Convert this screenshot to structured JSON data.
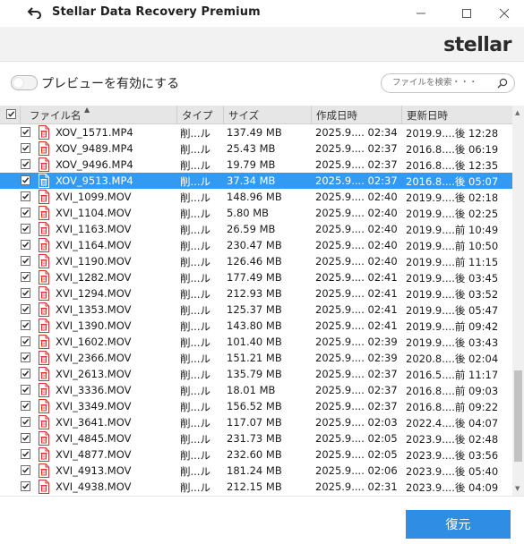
{
  "window": {
    "title": "Stellar Data Recovery Premium",
    "minimize_icon": "minimize-icon",
    "maximize_icon": "maximize-icon",
    "close_icon": "close-icon"
  },
  "brand": {
    "logo_prefix": "stel",
    "logo_mark": "l",
    "logo_suffix": "ar"
  },
  "toolbar": {
    "preview_toggle_label": "プレビューを有効にする",
    "preview_enabled": false,
    "search_placeholder": "ファイルを検索・・・"
  },
  "table": {
    "columns": [
      "ファイル名",
      "タイプ",
      "サイズ",
      "作成日時",
      "更新日時"
    ],
    "rows": [
      {
        "name": "XOV_1571.MP4",
        "type": "削...ル",
        "size": "137.49 MB",
        "created": "2025.9.... 02:34",
        "modified": "2019.9....後 12:28",
        "checked": true,
        "selected": false
      },
      {
        "name": "XOV_9489.MP4",
        "type": "削...ル",
        "size": "25.43 MB",
        "created": "2025.9.... 02:37",
        "modified": "2016.8....後 06:19",
        "checked": true,
        "selected": false
      },
      {
        "name": "XOV_9496.MP4",
        "type": "削...ル",
        "size": "19.79 MB",
        "created": "2025.9.... 02:37",
        "modified": "2016.8....後 12:35",
        "checked": true,
        "selected": false
      },
      {
        "name": "XOV_9513.MP4",
        "type": "削...ル",
        "size": "37.34 MB",
        "created": "2025.9.... 02:37",
        "modified": "2016.8....後 05:07",
        "checked": true,
        "selected": true
      },
      {
        "name": "XVI_1099.MOV",
        "type": "削...ル",
        "size": "148.96 MB",
        "created": "2025.9.... 02:40",
        "modified": "2019.9....後 02:18",
        "checked": true,
        "selected": false
      },
      {
        "name": "XVI_1104.MOV",
        "type": "削...ル",
        "size": "5.80 MB",
        "created": "2025.9.... 02:40",
        "modified": "2019.9....後 02:25",
        "checked": true,
        "selected": false
      },
      {
        "name": "XVI_1163.MOV",
        "type": "削...ル",
        "size": "26.59 MB",
        "created": "2025.9.... 02:40",
        "modified": "2019.9....前 10:49",
        "checked": true,
        "selected": false
      },
      {
        "name": "XVI_1164.MOV",
        "type": "削...ル",
        "size": "230.47 MB",
        "created": "2025.9.... 02:40",
        "modified": "2019.9....前 10:50",
        "checked": true,
        "selected": false
      },
      {
        "name": "XVI_1190.MOV",
        "type": "削...ル",
        "size": "126.46 MB",
        "created": "2025.9.... 02:40",
        "modified": "2019.9....前 11:15",
        "checked": true,
        "selected": false
      },
      {
        "name": "XVI_1282.MOV",
        "type": "削...ル",
        "size": "177.49 MB",
        "created": "2025.9.... 02:41",
        "modified": "2019.9....後 03:45",
        "checked": true,
        "selected": false
      },
      {
        "name": "XVI_1294.MOV",
        "type": "削...ル",
        "size": "212.93 MB",
        "created": "2025.9.... 02:41",
        "modified": "2019.9....後 03:52",
        "checked": true,
        "selected": false
      },
      {
        "name": "XVI_1353.MOV",
        "type": "削...ル",
        "size": "125.37 MB",
        "created": "2025.9.... 02:41",
        "modified": "2019.9....後 05:47",
        "checked": true,
        "selected": false
      },
      {
        "name": "XVI_1390.MOV",
        "type": "削...ル",
        "size": "143.80 MB",
        "created": "2025.9.... 02:41",
        "modified": "2019.9....前 09:42",
        "checked": true,
        "selected": false
      },
      {
        "name": "XVI_1602.MOV",
        "type": "削...ル",
        "size": "101.40 MB",
        "created": "2025.9.... 02:39",
        "modified": "2019.9....後 03:43",
        "checked": true,
        "selected": false
      },
      {
        "name": "XVI_2366.MOV",
        "type": "削...ル",
        "size": "151.21 MB",
        "created": "2025.9.... 02:39",
        "modified": "2020.8....後 02:04",
        "checked": true,
        "selected": false
      },
      {
        "name": "XVI_2613.MOV",
        "type": "削...ル",
        "size": "135.79 MB",
        "created": "2025.9.... 02:37",
        "modified": "2016.5....前 11:17",
        "checked": true,
        "selected": false
      },
      {
        "name": "XVI_3336.MOV",
        "type": "削...ル",
        "size": "18.01 MB",
        "created": "2025.9.... 02:37",
        "modified": "2016.8....前 09:03",
        "checked": true,
        "selected": false
      },
      {
        "name": "XVI_3349.MOV",
        "type": "削...ル",
        "size": "156.52 MB",
        "created": "2025.9.... 02:37",
        "modified": "2016.8....前 09:22",
        "checked": true,
        "selected": false
      },
      {
        "name": "XVI_3641.MOV",
        "type": "削...ル",
        "size": "117.07 MB",
        "created": "2025.9.... 02:03",
        "modified": "2022.4....後 04:07",
        "checked": true,
        "selected": false
      },
      {
        "name": "XVI_4845.MOV",
        "type": "削...ル",
        "size": "231.73 MB",
        "created": "2025.9.... 02:05",
        "modified": "2023.9....後 02:48",
        "checked": true,
        "selected": false
      },
      {
        "name": "XVI_4877.MOV",
        "type": "削...ル",
        "size": "232.60 MB",
        "created": "2025.9.... 02:05",
        "modified": "2023.9....後 03:56",
        "checked": true,
        "selected": false
      },
      {
        "name": "XVI_4913.MOV",
        "type": "削...ル",
        "size": "181.24 MB",
        "created": "2025.9.... 02:06",
        "modified": "2023.9....後 05:40",
        "checked": true,
        "selected": false
      },
      {
        "name": "XVI_4938.MOV",
        "type": "削...ル",
        "size": "212.15 MB",
        "created": "2025.9.... 02:31",
        "modified": "2023.9....後 04:09",
        "checked": true,
        "selected": false
      }
    ]
  },
  "footer": {
    "recover_label": "復元"
  },
  "colors": {
    "selection": "#3399f1",
    "recover_button": "#2f8de4",
    "file_icon": "#d9342b"
  }
}
